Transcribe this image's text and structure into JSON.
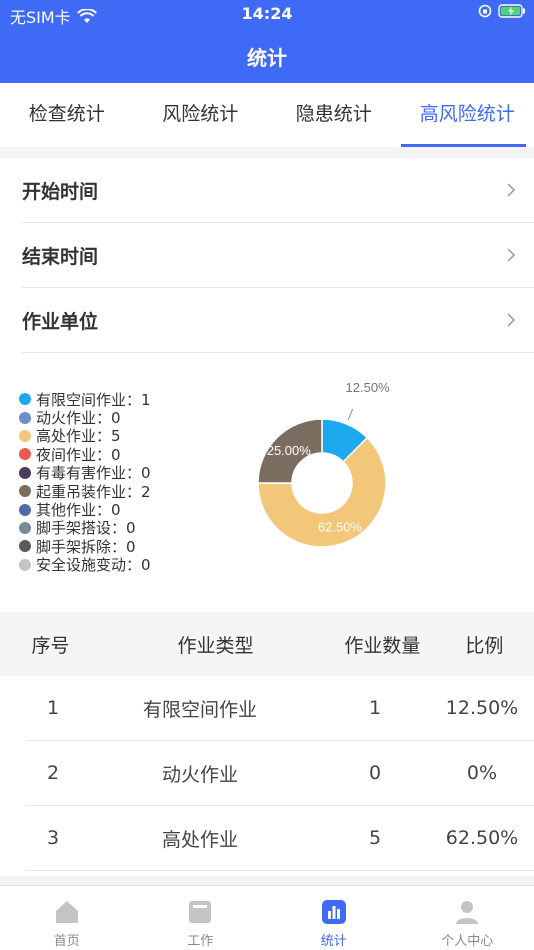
{
  "status_bar": {
    "carrier": "无SIM卡",
    "time": "14:24"
  },
  "nav": {
    "title": "统计"
  },
  "tabs": [
    {
      "label": "检查统计",
      "active": false
    },
    {
      "label": "风险统计",
      "active": false
    },
    {
      "label": "隐患统计",
      "active": false
    },
    {
      "label": "高风险统计",
      "active": true
    }
  ],
  "filters": [
    {
      "label": "开始时间"
    },
    {
      "label": "结束时间"
    },
    {
      "label": "作业单位"
    }
  ],
  "legend": [
    {
      "label": "有限空间作业：1",
      "color": "#1ba8ec"
    },
    {
      "label": "动火作业：0",
      "color": "#6a8fca"
    },
    {
      "label": "高处作业：5",
      "color": "#f2c77a"
    },
    {
      "label": "夜间作业：0",
      "color": "#ea5a4f"
    },
    {
      "label": "有毒有害作业：0",
      "color": "#4b3c5f"
    },
    {
      "label": "起重吊装作业：2",
      "color": "#7b6c60"
    },
    {
      "label": "其他作业：0",
      "color": "#4e6aa8"
    },
    {
      "label": "脚手架搭设：0",
      "color": "#7b8a92"
    },
    {
      "label": "脚手架拆除：0",
      "color": "#5a5a5a"
    },
    {
      "label": "安全设施变动：0",
      "color": "#c4c4c4"
    }
  ],
  "chart_data": {
    "type": "pie",
    "categories": [
      "有限空间作业",
      "动火作业",
      "高处作业",
      "夜间作业",
      "有毒有害作业",
      "起重吊装作业",
      "其他作业",
      "脚手架搭设",
      "脚手架拆除",
      "安全设施变动"
    ],
    "values": [
      1,
      0,
      5,
      0,
      0,
      2,
      0,
      0,
      0,
      0
    ],
    "slice_labels": [
      "12.50%",
      "",
      "62.50%",
      "",
      "",
      "25.00%",
      "",
      "",
      "",
      ""
    ],
    "colors": [
      "#1ba8ec",
      "#6a8fca",
      "#f2c77a",
      "#ea5a4f",
      "#4b3c5f",
      "#7b6c60",
      "#4e6aa8",
      "#7b8a92",
      "#5a5a5a",
      "#c4c4c4"
    ]
  },
  "table": {
    "headers": [
      "序号",
      "作业类型",
      "作业数量",
      "比例"
    ],
    "rows": [
      [
        "1",
        "有限空间作业",
        "1",
        "12.50%"
      ],
      [
        "2",
        "动火作业",
        "0",
        "0%"
      ],
      [
        "3",
        "高处作业",
        "5",
        "62.50%"
      ]
    ]
  },
  "tabbar": [
    {
      "label": "首页",
      "icon": "home-icon",
      "active": false
    },
    {
      "label": "工作",
      "icon": "work-icon",
      "active": false
    },
    {
      "label": "统计",
      "icon": "stats-icon",
      "active": true
    },
    {
      "label": "个人中心",
      "icon": "user-icon",
      "active": false
    }
  ]
}
